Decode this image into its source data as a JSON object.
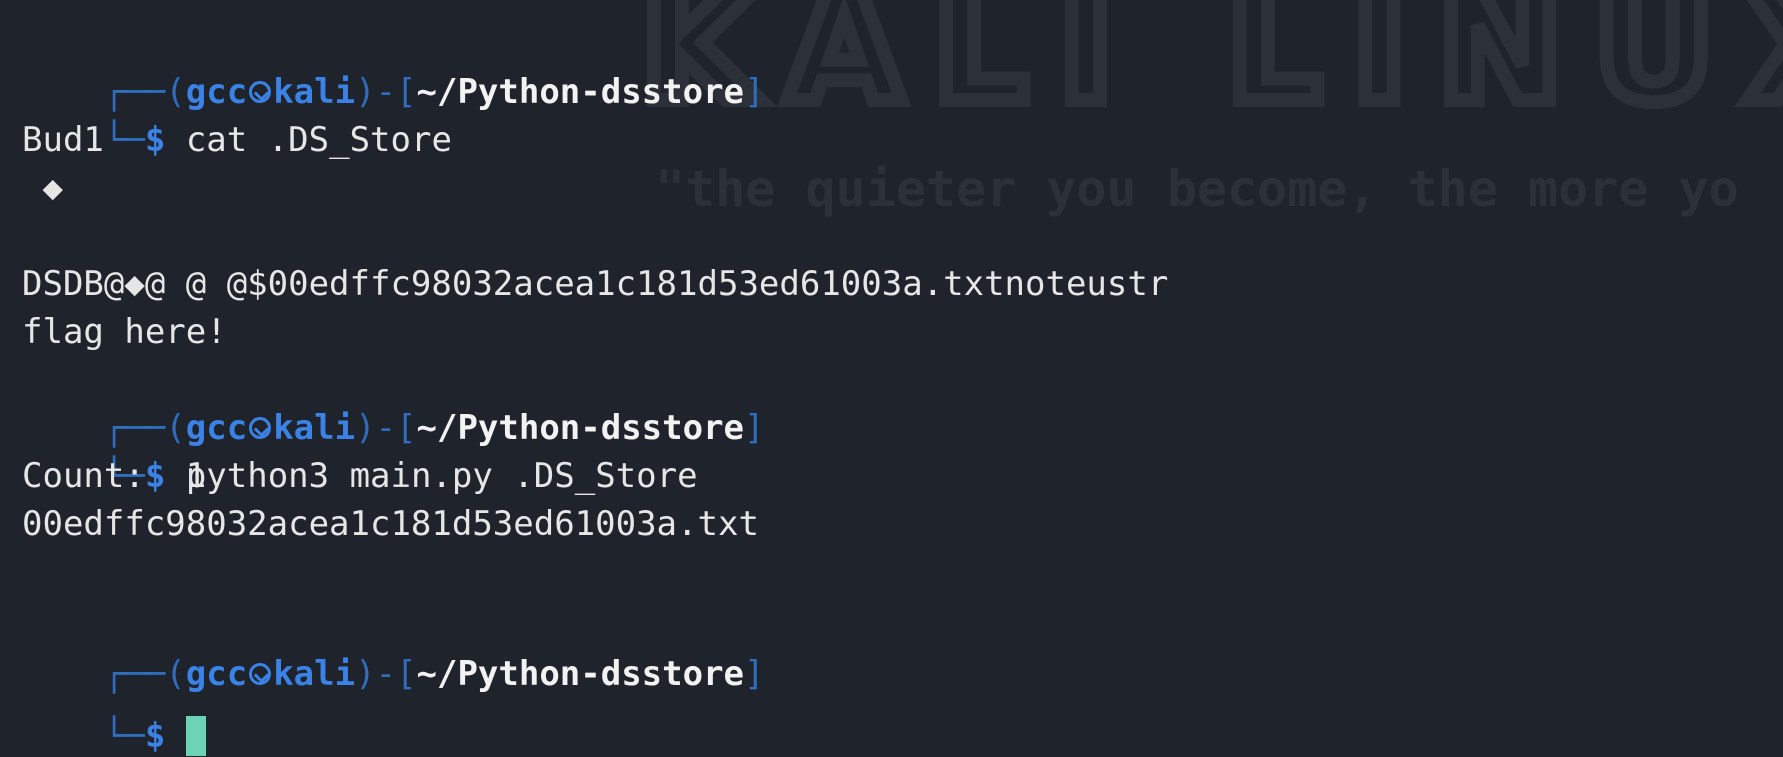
{
  "watermark": {
    "logo_text": "KALI LINUX",
    "tagline": "\"the quieter you become, the more yo"
  },
  "prompt": {
    "user": "gcc",
    "host": "kali",
    "path": "~/Python-dsstore",
    "symbol": "$"
  },
  "lines": {
    "cmd1": "cat .DS_Store",
    "out1": "Bud1",
    "out2": " ◆",
    "out3": "DSDB@◆@ @ @$00edffc98032acea1c181d53ed61003a.txtnoteustr",
    "out4": "flag here!",
    "cmd2": "python3 main.py .DS_Store",
    "out5": "Count:  1",
    "out6": "00edffc98032acea1c181d53ed61003a.txt"
  },
  "colors": {
    "background": "#1f232b",
    "prompt_blue": "#3a82e6",
    "cursor": "#6ad4b4"
  }
}
